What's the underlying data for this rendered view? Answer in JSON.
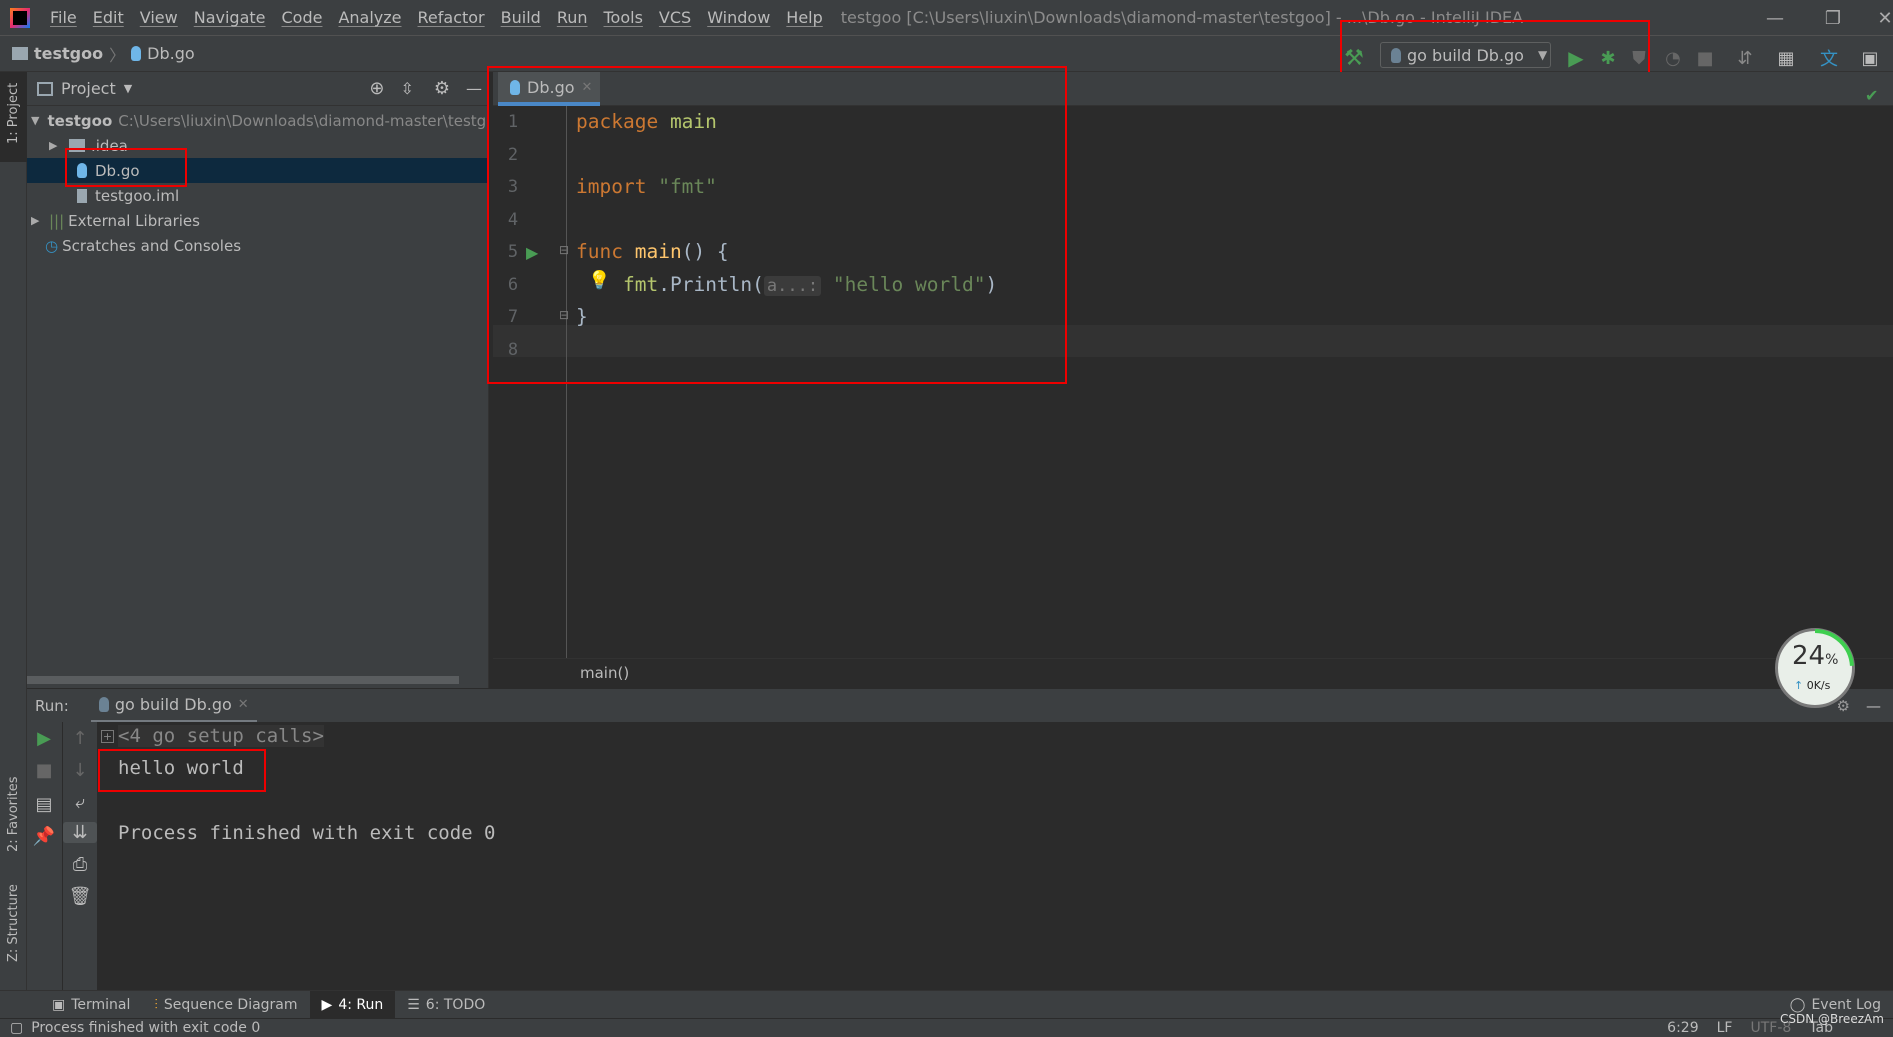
{
  "menubar": {
    "items": [
      "File",
      "Edit",
      "View",
      "Navigate",
      "Code",
      "Analyze",
      "Refactor",
      "Build",
      "Run",
      "Tools",
      "VCS",
      "Window",
      "Help"
    ],
    "title": "testgoo [C:\\Users\\liuxin\\Downloads\\diamond-master\\testgoo] - ...\\Db.go - IntelliJ IDEA"
  },
  "navbar": {
    "project": "testgoo",
    "file": "Db.go"
  },
  "toolbar": {
    "run_config": "go build Db.go"
  },
  "left_strip": {
    "project": "1: Project",
    "favorites": "2: Favorites",
    "structure": "Z: Structure"
  },
  "project_panel": {
    "title": "Project",
    "tree": [
      {
        "label": "testgoo",
        "path": "C:\\Users\\liuxin\\Downloads\\diamond-master\\testgoo"
      },
      {
        "label": ".idea"
      },
      {
        "label": "Db.go"
      },
      {
        "label": "testgoo.iml"
      },
      {
        "label": "External Libraries"
      },
      {
        "label": "Scratches and Consoles"
      }
    ]
  },
  "editor": {
    "tab": "Db.go",
    "line_numbers": [
      "1",
      "2",
      "3",
      "4",
      "5",
      "6",
      "7",
      "8"
    ],
    "code": {
      "l1_kw": "package",
      "l1_name": "main",
      "l3_kw": "import",
      "l3_str": "\"fmt\"",
      "l5_kw": "func",
      "l5_fn": "main",
      "l5_rest": "() {",
      "l6_pkg": "fmt",
      "l6_call": ".Println(",
      "l6_hint": "a...:",
      "l6_str": "\"hello world\"",
      "l6_close": ")",
      "l7": "}"
    },
    "breadcrumb": "main()"
  },
  "run": {
    "label": "Run:",
    "tab": "go build Db.go",
    "console": [
      "<4 go setup calls>",
      "hello world",
      "Process finished with exit code 0"
    ]
  },
  "gauge": {
    "percent": 24,
    "percent_label": "24",
    "unit": "%",
    "speed": "0K/s"
  },
  "tool_windows": [
    "Terminal",
    "Sequence Diagram",
    "4: Run",
    "6: TODO"
  ],
  "event_log": "Event Log",
  "status": {
    "message": "Process finished with exit code 0",
    "position": "6:29",
    "line_sep": "LF",
    "encoding": "UTF-8",
    "indent": "Tab",
    "watermark": "CSDN @BreezAm"
  },
  "colors": {
    "keyword": "#cc7832",
    "function": "#ffc66d",
    "string": "#6a8759",
    "accent": "#4a88c7",
    "highlight": "#e00000"
  }
}
